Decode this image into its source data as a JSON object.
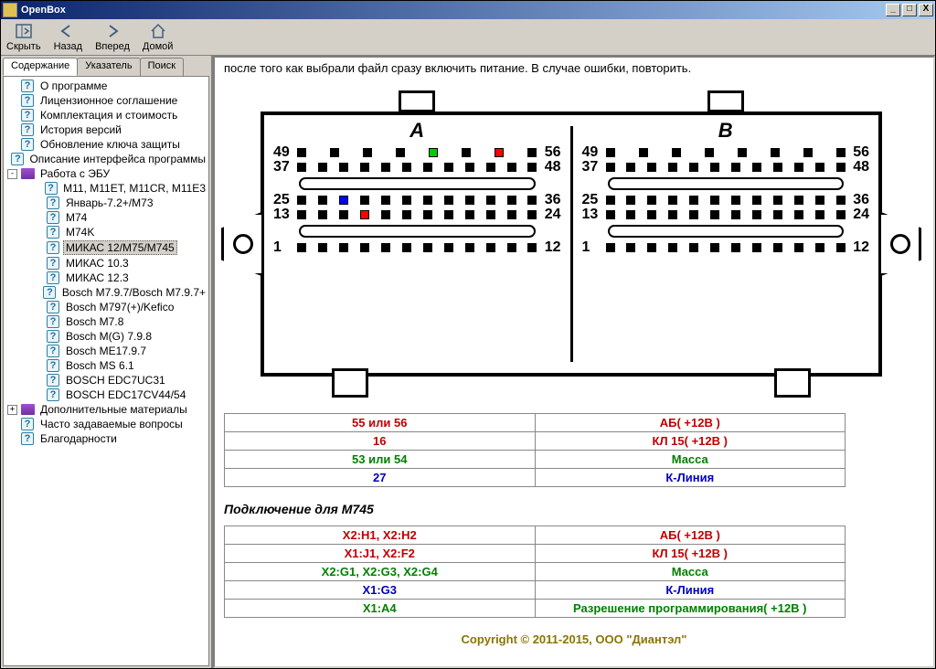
{
  "window": {
    "title": "OpenBox"
  },
  "toolbar": {
    "hide": "Скрыть",
    "back": "Назад",
    "forward": "Вперед",
    "home": "Домой"
  },
  "tabs": {
    "contents": "Содержание",
    "index": "Указатель",
    "search": "Поиск"
  },
  "tree": [
    {
      "label": "О программе",
      "icon": "q",
      "level": 1
    },
    {
      "label": "Лицензионное соглашение",
      "icon": "q",
      "level": 1
    },
    {
      "label": "Комплектация и стоимость",
      "icon": "q",
      "level": 1
    },
    {
      "label": "История версий",
      "icon": "q",
      "level": 1
    },
    {
      "label": "Обновление ключа защиты",
      "icon": "q",
      "level": 1
    },
    {
      "label": "Описание интерфейса программы",
      "icon": "q",
      "level": 1
    },
    {
      "label": "Работа с ЭБУ",
      "icon": "book",
      "level": 0,
      "toggle": "-"
    },
    {
      "label": "M11, M11ET, M11CR, M11E3",
      "icon": "q",
      "level": 2
    },
    {
      "label": "Январь-7.2+/M73",
      "icon": "q",
      "level": 2
    },
    {
      "label": "M74",
      "icon": "q",
      "level": 2
    },
    {
      "label": "M74K",
      "icon": "q",
      "level": 2
    },
    {
      "label": "МИКАС 12/M75/M745",
      "icon": "q",
      "level": 2,
      "selected": true
    },
    {
      "label": "МИКАС 10.3",
      "icon": "q",
      "level": 2
    },
    {
      "label": "МИКАС 12.3",
      "icon": "q",
      "level": 2
    },
    {
      "label": "Bosch M7.9.7/Bosch M7.9.7+",
      "icon": "q",
      "level": 2
    },
    {
      "label": "Bosch M797(+)/Kefico",
      "icon": "q",
      "level": 2
    },
    {
      "label": "Bosch M7.8",
      "icon": "q",
      "level": 2
    },
    {
      "label": "Bosch M(G) 7.9.8",
      "icon": "q",
      "level": 2
    },
    {
      "label": "Bosch ME17.9.7",
      "icon": "q",
      "level": 2
    },
    {
      "label": "Bosch MS 6.1",
      "icon": "q",
      "level": 2
    },
    {
      "label": "BOSCH EDC7UC31",
      "icon": "q",
      "level": 2
    },
    {
      "label": "BOSCH EDC17CV44/54",
      "icon": "q",
      "level": 2
    },
    {
      "label": "Дополнительные материалы",
      "icon": "book",
      "level": 0,
      "toggle": "+"
    },
    {
      "label": "Часто задаваемые вопросы",
      "icon": "q",
      "level": 1
    },
    {
      "label": "Благодарности",
      "icon": "q",
      "level": 1
    }
  ],
  "content": {
    "top_text": "после того как выбрали файл сразу включить питание. В случае ошибки, повторить.",
    "connectors": {
      "A": {
        "rows": [
          {
            "l": "49",
            "r": "56"
          },
          {
            "l": "37",
            "r": "48"
          },
          {
            "l": "25",
            "r": "36"
          },
          {
            "l": "13",
            "r": "24"
          },
          {
            "l": "1",
            "r": "12"
          }
        ]
      },
      "B": {
        "rows": [
          {
            "l": "49",
            "r": "56"
          },
          {
            "l": "37",
            "r": "48"
          },
          {
            "l": "25",
            "r": "36"
          },
          {
            "l": "13",
            "r": "24"
          },
          {
            "l": "1",
            "r": "12"
          }
        ]
      }
    },
    "table1": [
      {
        "left": "55 или 56",
        "right": "АБ( +12В )",
        "cls": "c-red"
      },
      {
        "left": "16",
        "right": "КЛ 15( +12В )",
        "cls": "c-red"
      },
      {
        "left": "53 или 54",
        "right": "Масса",
        "cls": "c-green"
      },
      {
        "left": "27",
        "right": "К-Линия",
        "cls": "c-blue"
      }
    ],
    "subheading": "Подключение для M745",
    "table2": [
      {
        "left": "X2:H1, X2:H2",
        "right": "АБ( +12В )",
        "cls": "c-red"
      },
      {
        "left": "X1:J1, X2:F2",
        "right": "КЛ 15( +12В )",
        "cls": "c-red"
      },
      {
        "left": "X2:G1, X2:G3, X2:G4",
        "right": "Масса",
        "cls": "c-green"
      },
      {
        "left": "X1:G3",
        "right": "К-Линия",
        "cls": "c-blue"
      },
      {
        "left": "X1:A4",
        "right": "Разрешение программирования( +12В )",
        "cls": "c-green"
      }
    ],
    "copyright": "Copyright © 2011-2015, ООО \"Диантэл\""
  }
}
